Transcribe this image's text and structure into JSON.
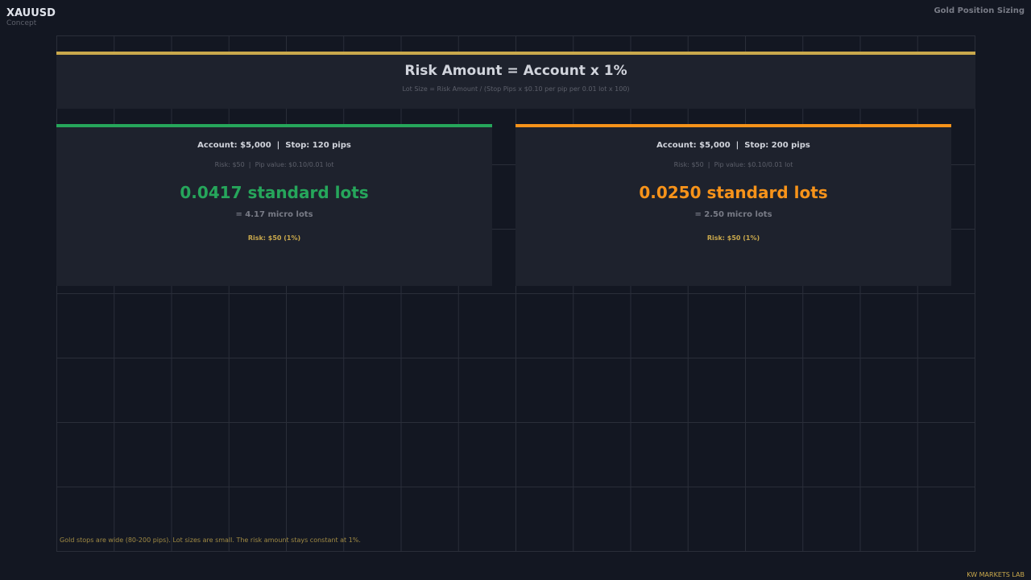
{
  "header": {
    "symbol": "XAUUSD",
    "subtitle": "Concept",
    "title": "Gold Position Sizing"
  },
  "formula": {
    "main": "Risk Amount = Account x 1%",
    "sub": "Lot Size = Risk Amount / (Stop Pips x $0.10 per pip per 0.01 lot x 100)"
  },
  "cards": [
    {
      "heading": "Account: $5,000  |  Stop: 120 pips",
      "details": "Risk: $50  |  Pip value: $0.10/0.01 lot",
      "lots": "0.0417 standard lots",
      "micro": "= 4.17 micro lots",
      "risk": "Risk: $50 (1%)",
      "accent": "#26a65b"
    },
    {
      "heading": "Account: $5,000  |  Stop: 200 pips",
      "details": "Risk: $50  |  Pip value: $0.10/0.01 lot",
      "lots": "0.0250 standard lots",
      "micro": "= 2.50 micro lots",
      "risk": "Risk: $50 (1%)",
      "accent": "#f7931a"
    }
  ],
  "footnote": "Gold stops are wide (80-200 pips). Lot sizes are small. The risk amount stays constant at 1%.",
  "brand": "KW MARKETS LAB",
  "colors": {
    "background": "#131722",
    "panel": "#1e222d",
    "gold": "#c9a84c",
    "green": "#26a65b",
    "orange": "#f7931a"
  }
}
